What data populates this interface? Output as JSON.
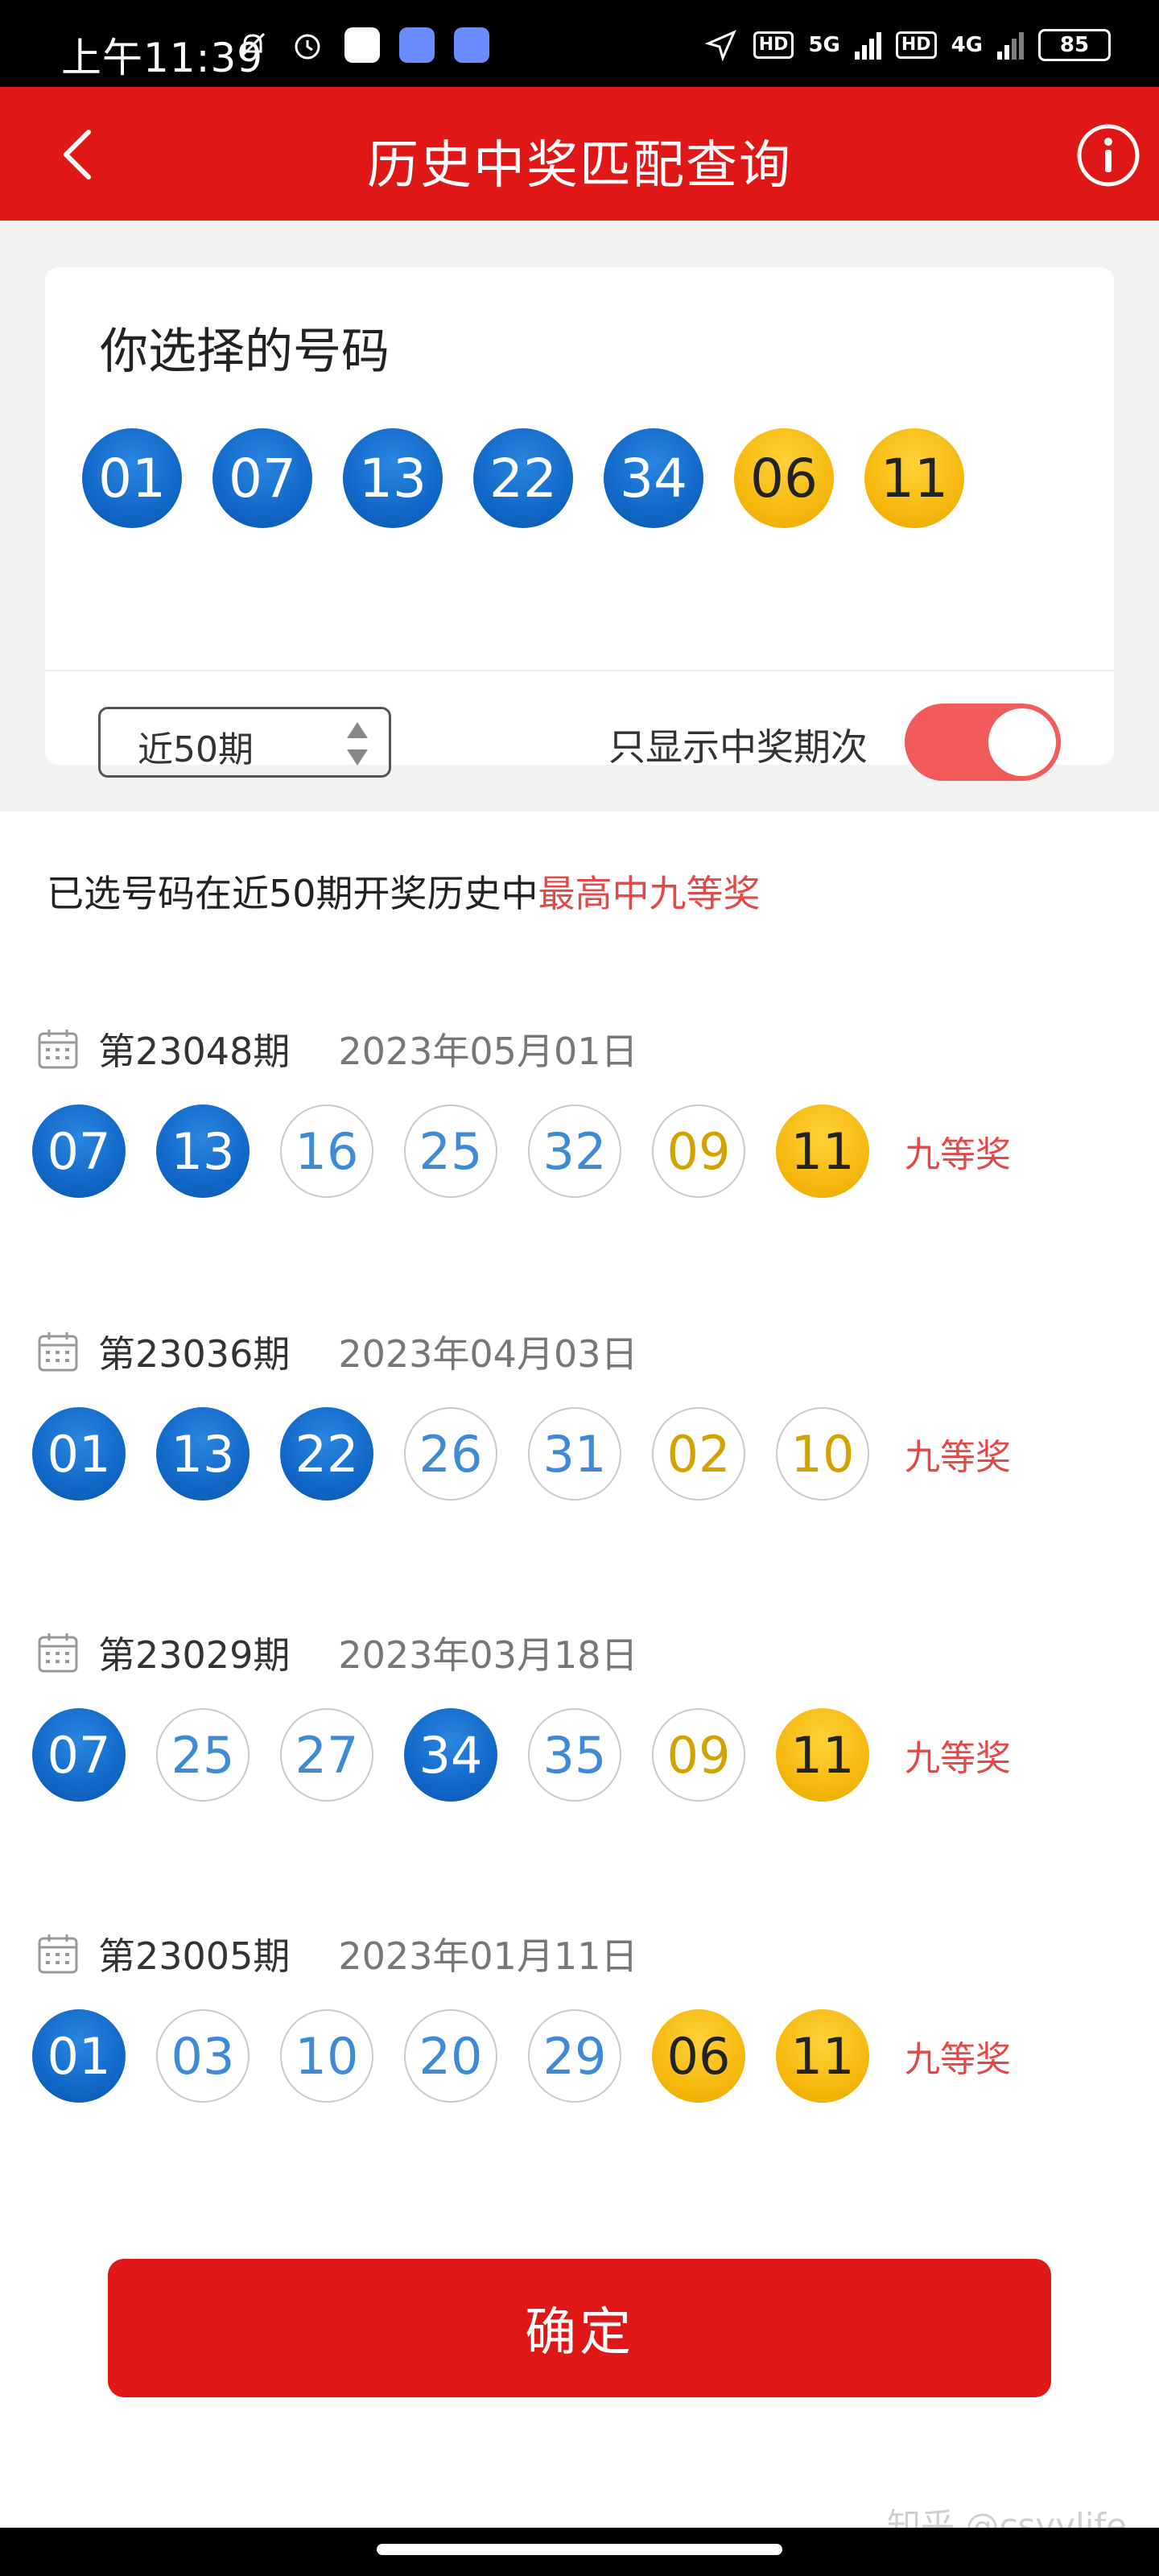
{
  "status_bar": {
    "time": "上午11:39",
    "network_5g": "5G",
    "network_4g": "4G",
    "hd1": "HD",
    "hd2": "HD",
    "battery": "85",
    "icons": [
      "mute-bell-icon",
      "alarm-icon",
      "app-icon-1",
      "app-icon-2",
      "app-icon-3",
      "location-icon",
      "signal-icon",
      "battery-icon"
    ]
  },
  "nav": {
    "title": "历史中奖匹配查询",
    "back_icon": "chevron-left-icon",
    "info_icon": "info-icon"
  },
  "selection": {
    "title": "你选择的号码",
    "front_numbers": [
      "01",
      "07",
      "13",
      "22",
      "34"
    ],
    "back_numbers": [
      "06",
      "11"
    ],
    "period_label": "近50期",
    "toggle_label": "只显示中奖期次",
    "toggle_on": true
  },
  "summary": {
    "text": "已选号码在近50期开奖历史中",
    "highlight": "最高中九等奖"
  },
  "draws": [
    {
      "period": "第23048期",
      "date": "2023年05月01日",
      "balls": [
        {
          "num": "07",
          "kind": "blue-hit"
        },
        {
          "num": "13",
          "kind": "blue-hit"
        },
        {
          "num": "16",
          "kind": "blue-miss"
        },
        {
          "num": "25",
          "kind": "blue-miss"
        },
        {
          "num": "32",
          "kind": "blue-miss"
        },
        {
          "num": "09",
          "kind": "yellow-miss"
        },
        {
          "num": "11",
          "kind": "yellow-hit"
        }
      ],
      "prize": "九等奖"
    },
    {
      "period": "第23036期",
      "date": "2023年04月03日",
      "balls": [
        {
          "num": "01",
          "kind": "blue-hit"
        },
        {
          "num": "13",
          "kind": "blue-hit"
        },
        {
          "num": "22",
          "kind": "blue-hit"
        },
        {
          "num": "26",
          "kind": "blue-miss"
        },
        {
          "num": "31",
          "kind": "blue-miss"
        },
        {
          "num": "02",
          "kind": "yellow-miss"
        },
        {
          "num": "10",
          "kind": "yellow-miss"
        }
      ],
      "prize": "九等奖"
    },
    {
      "period": "第23029期",
      "date": "2023年03月18日",
      "balls": [
        {
          "num": "07",
          "kind": "blue-hit"
        },
        {
          "num": "25",
          "kind": "blue-miss"
        },
        {
          "num": "27",
          "kind": "blue-miss"
        },
        {
          "num": "34",
          "kind": "blue-hit"
        },
        {
          "num": "35",
          "kind": "blue-miss"
        },
        {
          "num": "09",
          "kind": "yellow-miss"
        },
        {
          "num": "11",
          "kind": "yellow-hit"
        }
      ],
      "prize": "九等奖"
    },
    {
      "period": "第23005期",
      "date": "2023年01月11日",
      "balls": [
        {
          "num": "01",
          "kind": "blue-hit"
        },
        {
          "num": "03",
          "kind": "blue-miss"
        },
        {
          "num": "10",
          "kind": "blue-miss"
        },
        {
          "num": "20",
          "kind": "blue-miss"
        },
        {
          "num": "29",
          "kind": "blue-miss"
        },
        {
          "num": "06",
          "kind": "yellow-hit"
        },
        {
          "num": "11",
          "kind": "yellow-hit"
        }
      ],
      "prize": "九等奖"
    }
  ],
  "confirm_label": "确定",
  "watermark": "知乎 @csyylife",
  "colors": {
    "brand_red": "#e01717",
    "prize_red": "#e24a4a",
    "ball_blue": "#1268c8",
    "ball_yellow": "#f5b70b",
    "toggle_on": "#f25b5b"
  }
}
